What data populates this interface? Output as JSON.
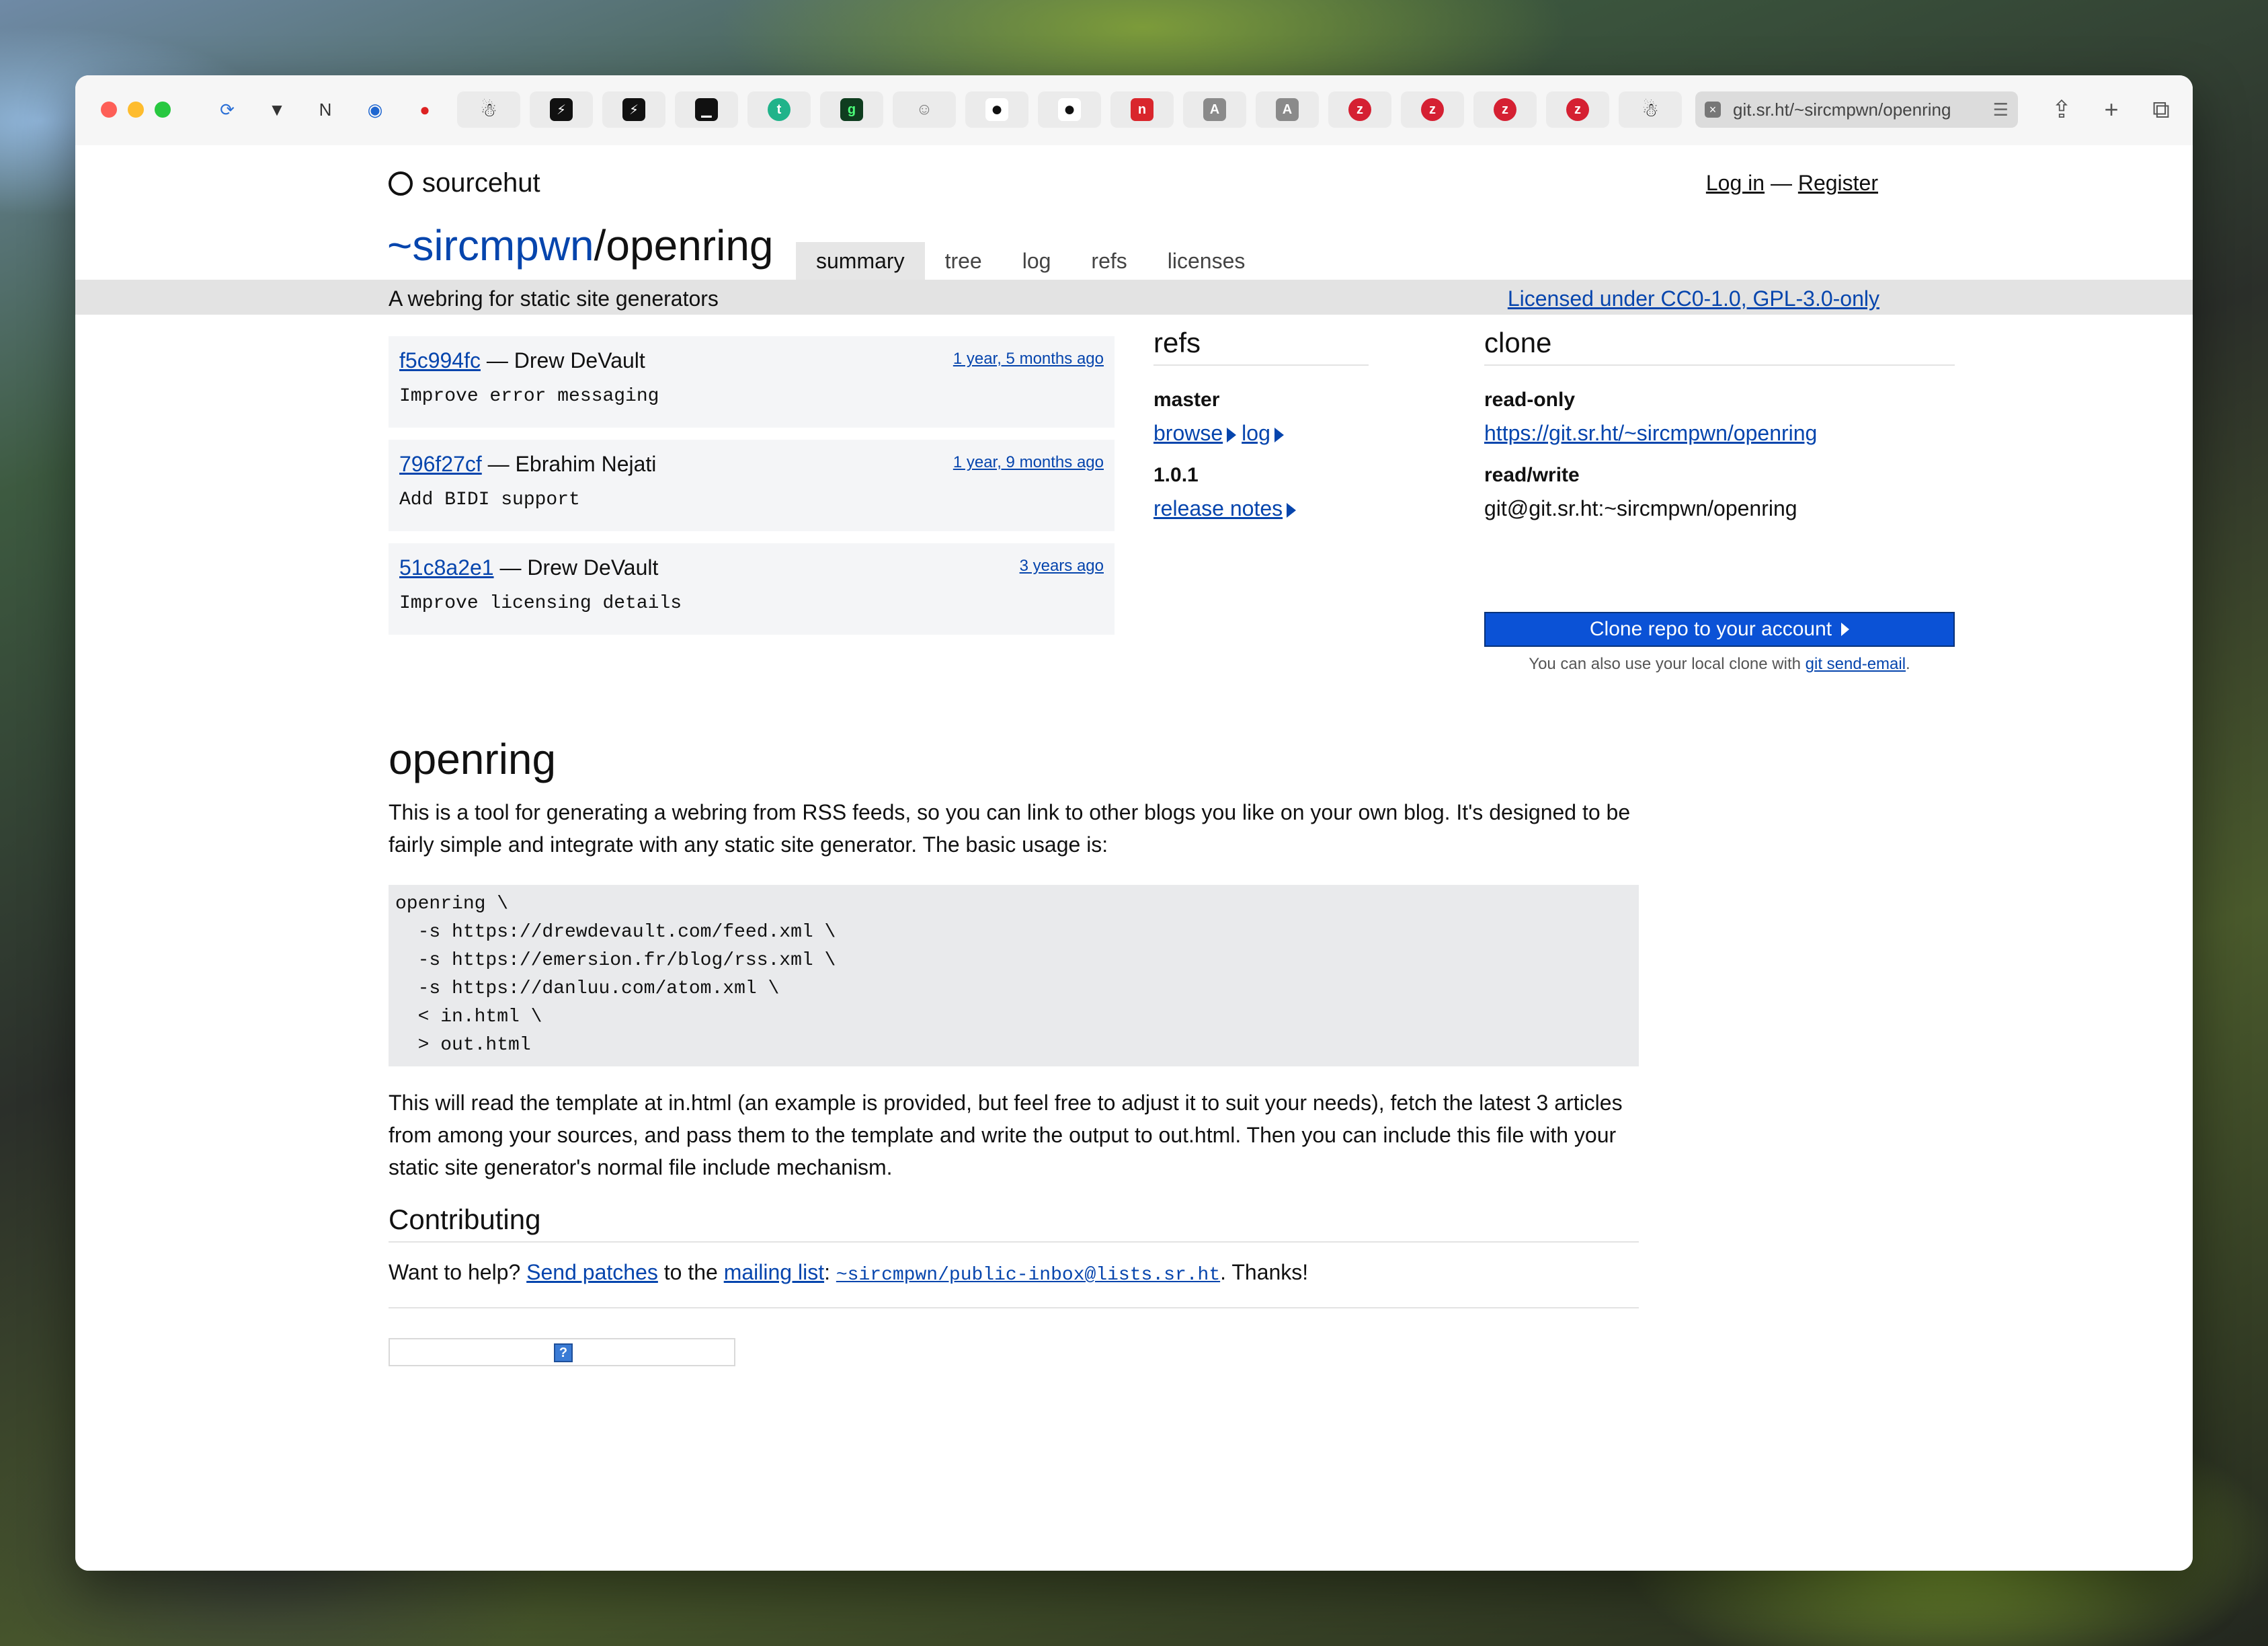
{
  "browser": {
    "active_tab_url": "git.sr.ht/~sircmpwn/openring",
    "tabs": [
      {
        "icon": "sticker-figure-icon"
      },
      {
        "icon": "bolt-icon"
      },
      {
        "icon": "bolt-icon"
      },
      {
        "icon": "terminal-icon"
      },
      {
        "icon": "letter-t-icon"
      },
      {
        "icon": "letter-g-icon"
      },
      {
        "icon": "ghost-icon"
      },
      {
        "icon": "github-icon"
      },
      {
        "icon": "github-icon"
      },
      {
        "icon": "red-square-icon"
      },
      {
        "icon": "letter-a-icon"
      },
      {
        "icon": "letter-a-icon"
      },
      {
        "icon": "red-circle-icon"
      },
      {
        "icon": "red-circle-icon"
      },
      {
        "icon": "red-circle-icon"
      },
      {
        "icon": "red-circle-icon"
      },
      {
        "icon": "sticker-figure-icon"
      }
    ]
  },
  "site": {
    "brand": "sourcehut",
    "login": "Log in",
    "separator": "—",
    "register": "Register"
  },
  "repo": {
    "owner": "~sircmpwn",
    "slash": "/",
    "name": "openring",
    "tabs": [
      "summary",
      "tree",
      "log",
      "refs",
      "licenses"
    ],
    "active_tab": "summary",
    "description": "A webring for static site generators",
    "license": "Licensed under CC0-1.0, GPL-3.0-only"
  },
  "commits": [
    {
      "hash": "f5c994fc",
      "author": "— Drew DeVault",
      "ago": "1 year, 5 months ago",
      "message": "Improve error messaging"
    },
    {
      "hash": "796f27cf",
      "author": "— Ebrahim Nejati",
      "ago": "1 year, 9 months ago",
      "message": "Add BIDI support"
    },
    {
      "hash": "51c8a2e1",
      "author": "— Drew DeVault",
      "ago": "3 years ago",
      "message": "Improve licensing details"
    }
  ],
  "refs": {
    "title": "refs",
    "branch": "master",
    "browse": "browse",
    "log": "log",
    "tag": "1.0.1",
    "release_notes": "release notes"
  },
  "clone": {
    "title": "clone",
    "readonly_label": "read-only",
    "readonly_url": "https://git.sr.ht/~sircmpwn/openring",
    "readwrite_label": "read/write",
    "readwrite_url": "git@git.sr.ht:~sircmpwn/openring",
    "button": "Clone repo to your account",
    "note_prefix": "You can also use your local clone with ",
    "note_link": "git send-email",
    "note_suffix": "."
  },
  "readme": {
    "title": "openring",
    "intro": "This is a tool for generating a webring from RSS feeds, so you can link to other blogs you like on your own blog. It's designed to be fairly simple and integrate with any static site generator. The basic usage is:",
    "code": "openring \\\n  -s https://drewdevault.com/feed.xml \\\n  -s https://emersion.fr/blog/rss.xml \\\n  -s https://danluu.com/atom.xml \\\n  < in.html \\\n  > out.html",
    "after_code": "This will read the template at in.html (an example is provided, but feel free to adjust it to suit your needs), fetch the latest 3 articles from among your sources, and pass them to the template and write the output to out.html. Then you can include this file with your static site generator's normal file include mechanism.",
    "contributing_title": "Contributing",
    "contrib_prefix": "Want to help? ",
    "send_patches": "Send patches",
    "contrib_mid": " to the ",
    "mailing_list": "mailing list",
    "contrib_colon": ": ",
    "list_address": "~sircmpwn/public-inbox@lists.sr.ht",
    "contrib_suffix": ". Thanks!"
  }
}
